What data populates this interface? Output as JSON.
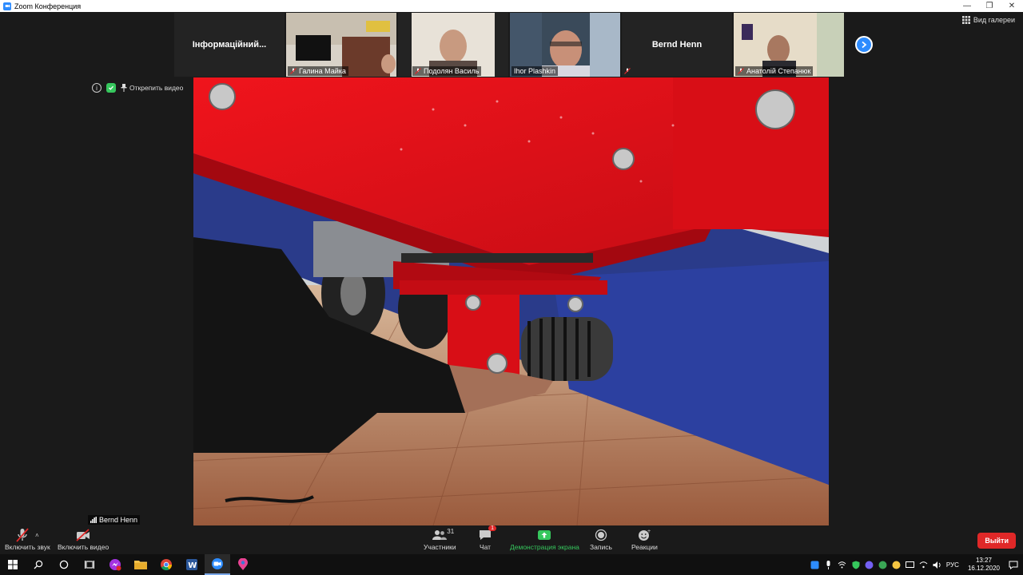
{
  "window": {
    "title": "Zoom Конференция",
    "minimize": "—",
    "restore": "❐",
    "close": "✕"
  },
  "gallery": {
    "participants": [
      {
        "name": "Інформаційний...",
        "type": "text",
        "muted": false
      },
      {
        "name": "Галина Майка",
        "type": "video",
        "muted": true
      },
      {
        "name": "Подолян Василь",
        "type": "video",
        "muted": true
      },
      {
        "name": "Ihor Plashkin",
        "type": "video",
        "muted": false
      },
      {
        "name": "Bernd Henn",
        "type": "text",
        "muted": true
      },
      {
        "name": "Анатолій Степанюк",
        "type": "video",
        "muted": true
      }
    ],
    "view_label": "Вид галереи"
  },
  "video_tools": {
    "unpin_label": "Открепить видео"
  },
  "active_speaker": {
    "name": "Bernd Henn"
  },
  "controls": {
    "audio_label": "Включить звук",
    "video_label": "Включить видео",
    "participants_label": "Участники",
    "participants_count": "31",
    "chat_label": "Чат",
    "chat_badge": "1",
    "share_label": "Демонстрация экрана",
    "record_label": "Запись",
    "reactions_label": "Реакции",
    "leave_label": "Выйти"
  },
  "taskbar": {
    "lang": "РУС",
    "time": "13:27",
    "date": "16.12.2020"
  },
  "colors": {
    "zoom_blue": "#2d8cff",
    "leave_red": "#e02828",
    "share_green": "#36c75d"
  }
}
